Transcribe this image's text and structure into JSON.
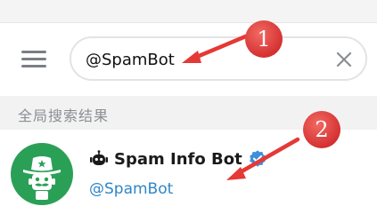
{
  "search": {
    "value": "@SpamBot",
    "placeholder": ""
  },
  "section": {
    "title": "全局搜索结果"
  },
  "result": {
    "name": "Spam Info Bot",
    "username": "@SpamBot"
  },
  "annotations": {
    "marker_1": "1",
    "marker_2": "2",
    "color": "#e53935"
  },
  "colors": {
    "avatar_bg": "#2aa057",
    "username": "#2f86c8",
    "verified": "#3d8fdd",
    "section_bg": "#f2f2f3"
  },
  "icons": {
    "menu": "hamburger-menu-icon",
    "clear": "close-icon",
    "bot": "bot-icon",
    "verified": "verified-badge-icon"
  }
}
